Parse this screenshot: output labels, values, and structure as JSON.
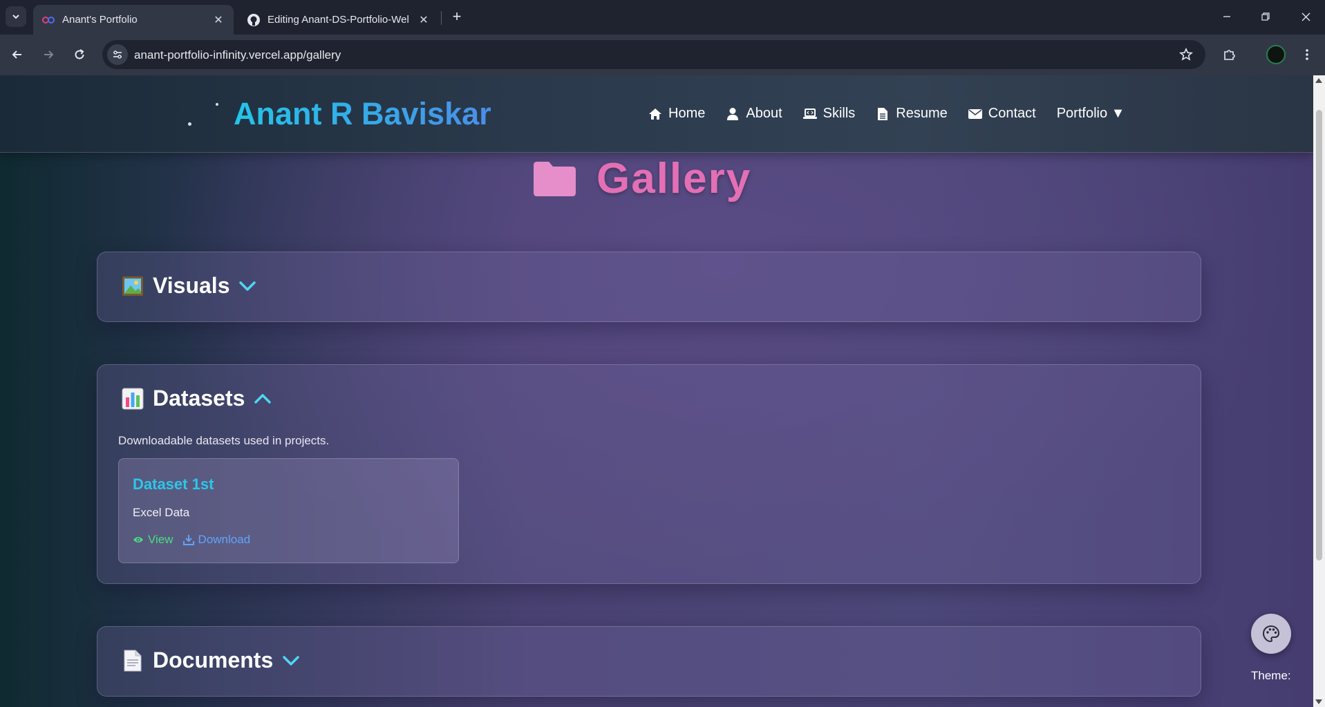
{
  "browser": {
    "tabs": [
      {
        "title": "Anant's Portfolio",
        "favicon": "infinity-icon",
        "active": true
      },
      {
        "title": "Editing Anant-DS-Portfolio-Wel",
        "favicon": "github-icon",
        "active": false
      }
    ],
    "url": "anant-portfolio-infinity.vercel.app/gallery"
  },
  "header": {
    "brand": "Anant R Baviskar",
    "nav": [
      {
        "label": "Home",
        "icon": "home-icon"
      },
      {
        "label": "About",
        "icon": "user-icon"
      },
      {
        "label": "Skills",
        "icon": "laptop-code-icon"
      },
      {
        "label": "Resume",
        "icon": "file-icon"
      },
      {
        "label": "Contact",
        "icon": "envelope-icon"
      },
      {
        "label": "Portfolio ▼",
        "icon": null
      }
    ]
  },
  "page": {
    "title": "Gallery",
    "title_icon": "folder-icon"
  },
  "sections": {
    "visuals": {
      "emoji": "picture-icon",
      "label": "Visuals",
      "expanded": false
    },
    "datasets": {
      "emoji": "bar-chart-icon",
      "label": "Datasets",
      "expanded": true,
      "description": "Downloadable datasets used in projects.",
      "cards": [
        {
          "title": "Dataset 1st",
          "subtitle": "Excel Data",
          "view_label": "View",
          "download_label": "Download"
        }
      ]
    },
    "documents": {
      "emoji": "document-icon",
      "label": "Documents",
      "expanded": false
    }
  },
  "theme": {
    "label": "Theme:"
  },
  "colors": {
    "brand_gradient_start": "#22c6e8",
    "brand_gradient_end": "#4a8fe8",
    "title_pink": "#e36fb5",
    "card_title": "#2dc6ea",
    "chevron": "#4fd6f0",
    "view_link": "#4ade80",
    "download_link": "#60a5fa"
  }
}
